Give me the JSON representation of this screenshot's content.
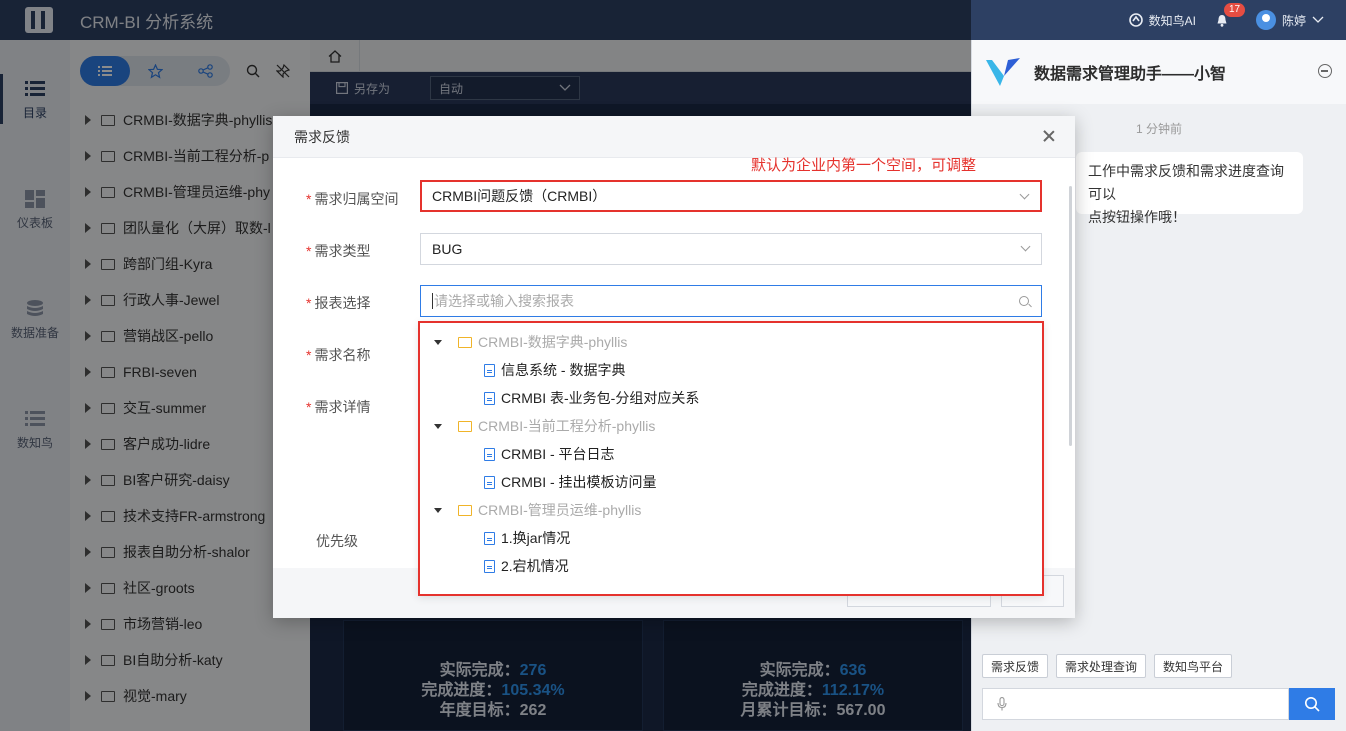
{
  "header": {
    "title": "CRM-BI 分析系统",
    "ai_label": "数知鸟AI",
    "notification_count": "17",
    "user_name": "陈婷"
  },
  "rail": {
    "items": [
      {
        "label": "目录"
      },
      {
        "label": "仪表板"
      },
      {
        "label": "数据准备"
      },
      {
        "label": "数知鸟"
      }
    ]
  },
  "tree": {
    "items": [
      "CRMBI-数据字典-phyllis",
      "CRMBI-当前工程分析-p",
      "CRMBI-管理员运维-phy",
      "团队量化（大屏）取数-l",
      "跨部门组-Kyra",
      "行政人事-Jewel",
      "营销战区-pello",
      "FRBI-seven",
      "交互-summer",
      "客户成功-lidre",
      "BI客户研究-daisy",
      "技术支持FR-armstrong",
      "报表自助分析-shalor",
      "社区-groots",
      "市场营销-leo",
      "BI自助分析-katy",
      "视觉-mary"
    ]
  },
  "main": {
    "saveas_label": "另存为",
    "auto_select": "自动",
    "card1": {
      "l1": "实际完成：",
      "v1": "276",
      "l2": "完成进度：",
      "v2": "105.34%",
      "l3": "年度目标：",
      "v3": "262"
    },
    "card2": {
      "l1": "实际完成：",
      "v1": "636",
      "l2": "完成进度：",
      "v2": "112.17%",
      "l3": "月累计目标：",
      "v3": "567.00"
    }
  },
  "assistant": {
    "title": "数据需求管理助手——小智",
    "time": "1 分钟前",
    "bubble_line1": "工作中需求反馈和需求进度查询可以",
    "bubble_line2": "点按钮操作哦！",
    "buttons": [
      "需求反馈",
      "需求处理查询",
      "数知鸟平台"
    ]
  },
  "dialog": {
    "title": "需求反馈",
    "note": "默认为企业内第一个空间，可调整",
    "fields": {
      "space_label": "需求归属空间",
      "space_value": "CRMBI问题反馈（CRMBI）",
      "type_label": "需求类型",
      "type_value": "BUG",
      "report_label": "报表选择",
      "report_placeholder": "请选择或输入搜索报表",
      "name_label": "需求名称",
      "detail_label": "需求详情",
      "priority_label": "优先级"
    },
    "dropdown": [
      {
        "group": "CRMBI-数据字典-phyllis",
        "leaves": [
          "信息系统 - 数据字典",
          "CRMBI 表-业务包-分组对应关系"
        ]
      },
      {
        "group": "CRMBI-当前工程分析-phyllis",
        "leaves": [
          "CRMBI - 平台日志",
          "CRMBI - 挂出模板访问量"
        ]
      },
      {
        "group": "CRMBI-管理员运维-phyllis",
        "leaves": [
          "1.换jar情况",
          "2.宕机情况"
        ]
      }
    ]
  },
  "colors": {
    "header_bg": "#2d4063",
    "accent": "#2f7ce6",
    "annotation_red": "#e5322d"
  }
}
